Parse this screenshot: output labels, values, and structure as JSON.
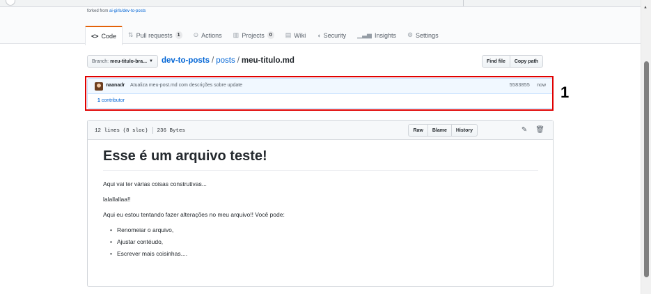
{
  "repo_header": {
    "forked_prefix": "forked from ",
    "forked_link": "ai-girls/dev-to-posts",
    "tabs": [
      {
        "label": "Code",
        "icon": "code-icon",
        "glyph": "<>",
        "selected": true
      },
      {
        "label": "Pull requests",
        "icon": "pull-request-icon",
        "glyph": "⇅",
        "count": "1"
      },
      {
        "label": "Actions",
        "icon": "actions-icon",
        "glyph": "⊙"
      },
      {
        "label": "Projects",
        "icon": "project-icon",
        "glyph": "▥",
        "count": "0"
      },
      {
        "label": "Wiki",
        "icon": "book-icon",
        "glyph": "▤"
      },
      {
        "label": "Security",
        "icon": "shield-icon",
        "glyph": "◖"
      },
      {
        "label": "Insights",
        "icon": "graph-icon",
        "glyph": "▁▃▅"
      },
      {
        "label": "Settings",
        "icon": "gear-icon",
        "glyph": "⚙"
      }
    ]
  },
  "file_nav": {
    "branch_label": "Branch:",
    "branch_value": "meu-titulo-bra...",
    "repo": "dev-to-posts",
    "dir": "posts",
    "sep": "/",
    "file": "meu-titulo.md",
    "find_file": "Find file",
    "copy_path": "Copy path"
  },
  "commit": {
    "author": "naanadr",
    "message": "Atualiza meu-post.md com descrições sobre update",
    "sha": "5583855",
    "when": "now",
    "contributor_count": "1",
    "contributor_label": "contributor"
  },
  "annotation": "1",
  "file": {
    "lines": "12 lines (8 sloc)",
    "size": "236 Bytes",
    "raw": "Raw",
    "blame": "Blame",
    "history": "History",
    "edit_icon": "pencil-icon",
    "delete_icon": "trash-icon"
  },
  "readme": {
    "heading": "Esse é um arquivo teste!",
    "p1": "Aqui vai ter várias coisas construtivas...",
    "p2": "lalallallaa!!",
    "p3": "Aqui eu estou tentando fazer alterações no meu arquivo!! Você pode:",
    "list": [
      "Renomeiar o arquivo,",
      "Ajustar contéudo,",
      "Escrever mais coisinhas...."
    ]
  },
  "colors": {
    "accent_tab": "#e36209",
    "link": "#0366d6",
    "highlight": "#e00000"
  }
}
